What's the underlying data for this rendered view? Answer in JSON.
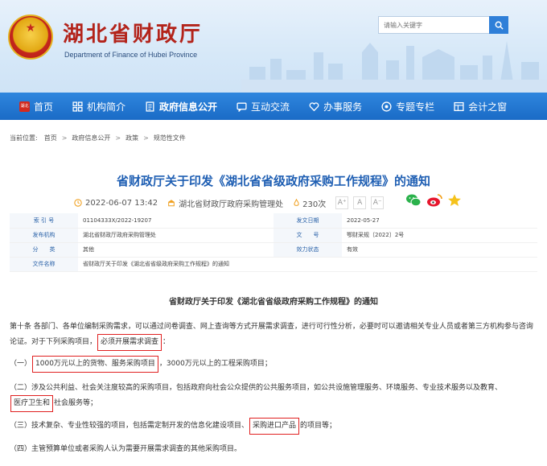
{
  "header": {
    "site_title": "湖北省财政厅",
    "site_subtitle": "Department of Finance of Hubei Province",
    "search_placeholder": "请输入关键字"
  },
  "nav": {
    "items": [
      {
        "label": "首页",
        "icon": "home-icon"
      },
      {
        "label": "机构简介",
        "icon": "grid-icon"
      },
      {
        "label": "政府信息公开",
        "icon": "document-icon",
        "active": true
      },
      {
        "label": "互动交流",
        "icon": "chat-icon"
      },
      {
        "label": "办事服务",
        "icon": "heart-icon"
      },
      {
        "label": "专题专栏",
        "icon": "target-icon"
      },
      {
        "label": "会计之窗",
        "icon": "window-icon"
      }
    ],
    "home_badge": "湖北"
  },
  "breadcrumb": {
    "label": "当前位置:",
    "items": [
      "首页",
      "政府信息公开",
      "政策",
      "规范性文件"
    ]
  },
  "article": {
    "title": "省财政厅关于印发《湖北省省级政府采购工作规程》的通知",
    "date": "2022-06-07 13:42",
    "source": "湖北省财政厅政府采购管理处",
    "views": "230次",
    "font_buttons": [
      "A⁺",
      "A",
      "A⁻"
    ]
  },
  "info": {
    "rows": [
      {
        "k1": "索 引 号",
        "v1": "01104333X/2022-19207",
        "k2": "发文日期",
        "v2": "2022-05-27"
      },
      {
        "k1": "发布机构",
        "v1": "湖北省财政厅政府采购管理处",
        "k2": "文　　号",
        "v2": "鄂财采规〔2022〕2号"
      },
      {
        "k1": "分　　类",
        "v1": "其他",
        "k2": "效力状态",
        "v2": "有效"
      },
      {
        "k1": "文件名称",
        "v1": "省财政厅关于印发《湖北省省级政府采购工作规程》的通知",
        "k2": "",
        "v2": ""
      }
    ]
  },
  "body": {
    "heading": "省财政厅关于印发《湖北省省级政府采购工作规程》的通知",
    "p1_a": "第十条  各部门、各单位编制采购需求，可以通过问卷调查、网上查询等方式开展需求调查，进行可行性分析，必要时可以邀请相关专业人员或者第三方机",
    "p1_b": "构参与咨询论证。对于下列采购项目，",
    "p1_hl": "必须开展需求调查",
    "p1_c": "：",
    "p2_a": "（一）",
    "p2_hl": "1000万元以上的货物、服务采购项目",
    "p2_b": "，3000万元以上的工程采购项目；",
    "p3_a": "（二）涉及公共利益、社会关注度较高的采购项目，包括政府向社会公众提供的公共服务项目，如公共设施管理服务、环境服务、专业技术服务以及教育、",
    "p3_hl": "医疗卫生和",
    "p3_b": "社会服务等；",
    "p4_a": "（三）技术复杂、专业性较强的项目，包括需定制开发的信息化建设项目、",
    "p4_hl": "采购进口产品",
    "p4_b": "的项目等；",
    "p5": "（四）主管预算单位或者采购人认为需要开展需求调查的其他采购项目。"
  }
}
